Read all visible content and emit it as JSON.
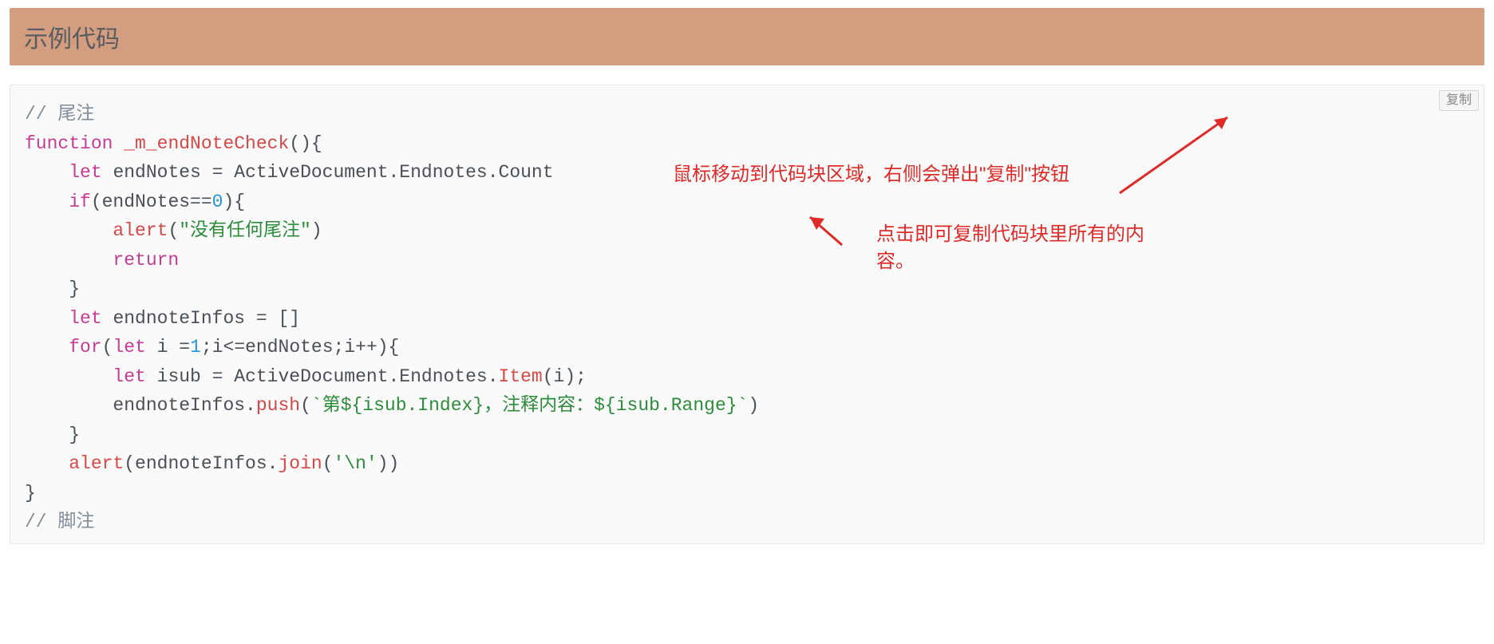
{
  "header": {
    "title": "示例代码"
  },
  "copy_button": {
    "label": "复制"
  },
  "annotations": {
    "line1": "鼠标移动到代码块区域，右侧会弹出\"复制\"按钮",
    "line2": "点击即可复制代码块里所有的内容。"
  },
  "colors": {
    "header_bg": "#d39d7f",
    "code_bg": "#fafafa",
    "annotation": "#df2a2a",
    "comment": "#808d99",
    "keyword": "#c53c94",
    "func_name": "#d64848",
    "number": "#2693e0",
    "string": "#2d8c3b"
  },
  "code": {
    "tokens": [
      [
        [
          "cm",
          "// 尾注"
        ]
      ],
      [
        [
          "kw",
          "function"
        ],
        [
          "id",
          " "
        ],
        [
          "fn",
          "_m_endNoteCheck"
        ],
        [
          "id",
          "(){"
        ]
      ],
      [
        [
          "id",
          "    "
        ],
        [
          "kw",
          "let"
        ],
        [
          "id",
          " endNotes = ActiveDocument.Endnotes.Count"
        ]
      ],
      [
        [
          "id",
          "    "
        ],
        [
          "kw",
          "if"
        ],
        [
          "id",
          "(endNotes=="
        ],
        [
          "num",
          "0"
        ],
        [
          "id",
          "){"
        ]
      ],
      [
        [
          "id",
          "        "
        ],
        [
          "call",
          "alert"
        ],
        [
          "id",
          "("
        ],
        [
          "str",
          "\"没有任何尾注\""
        ],
        [
          "id",
          ")"
        ]
      ],
      [
        [
          "id",
          "        "
        ],
        [
          "kw",
          "return"
        ]
      ],
      [
        [
          "id",
          "    }"
        ]
      ],
      [
        [
          "id",
          "    "
        ],
        [
          "kw",
          "let"
        ],
        [
          "id",
          " endnoteInfos = []"
        ]
      ],
      [
        [
          "id",
          "    "
        ],
        [
          "kw",
          "for"
        ],
        [
          "id",
          "("
        ],
        [
          "kw",
          "let"
        ],
        [
          "id",
          " i ="
        ],
        [
          "num",
          "1"
        ],
        [
          "id",
          ";i<=endNotes;i++){"
        ]
      ],
      [
        [
          "id",
          "        "
        ],
        [
          "kw",
          "let"
        ],
        [
          "id",
          " isub = ActiveDocument.Endnotes."
        ],
        [
          "call",
          "Item"
        ],
        [
          "id",
          "(i);"
        ]
      ],
      [
        [
          "id",
          "        endnoteInfos."
        ],
        [
          "call",
          "push"
        ],
        [
          "id",
          "("
        ],
        [
          "str",
          "`第${isub.Index}，注释内容：${isub.Range}`"
        ],
        [
          "id",
          ")"
        ]
      ],
      [
        [
          "id",
          "    }"
        ]
      ],
      [
        [
          "id",
          "    "
        ],
        [
          "call",
          "alert"
        ],
        [
          "id",
          "(endnoteInfos."
        ],
        [
          "call",
          "join"
        ],
        [
          "id",
          "("
        ],
        [
          "str",
          "'\\n'"
        ],
        [
          "id",
          "))"
        ]
      ],
      [
        [
          "id",
          "}"
        ]
      ],
      [
        [
          "cm",
          "// 脚注"
        ]
      ]
    ]
  }
}
